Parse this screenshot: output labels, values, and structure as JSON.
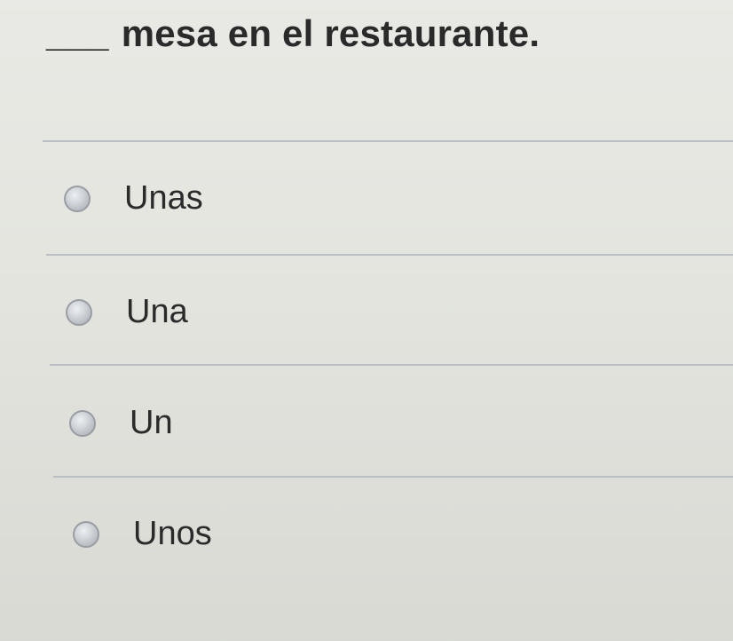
{
  "question": {
    "blank": "___",
    "text": "mesa en el restaurante."
  },
  "options": [
    {
      "label": "Unas",
      "selected": false
    },
    {
      "label": "Una",
      "selected": false
    },
    {
      "label": "Un",
      "selected": false
    },
    {
      "label": "Unos",
      "selected": false
    }
  ]
}
